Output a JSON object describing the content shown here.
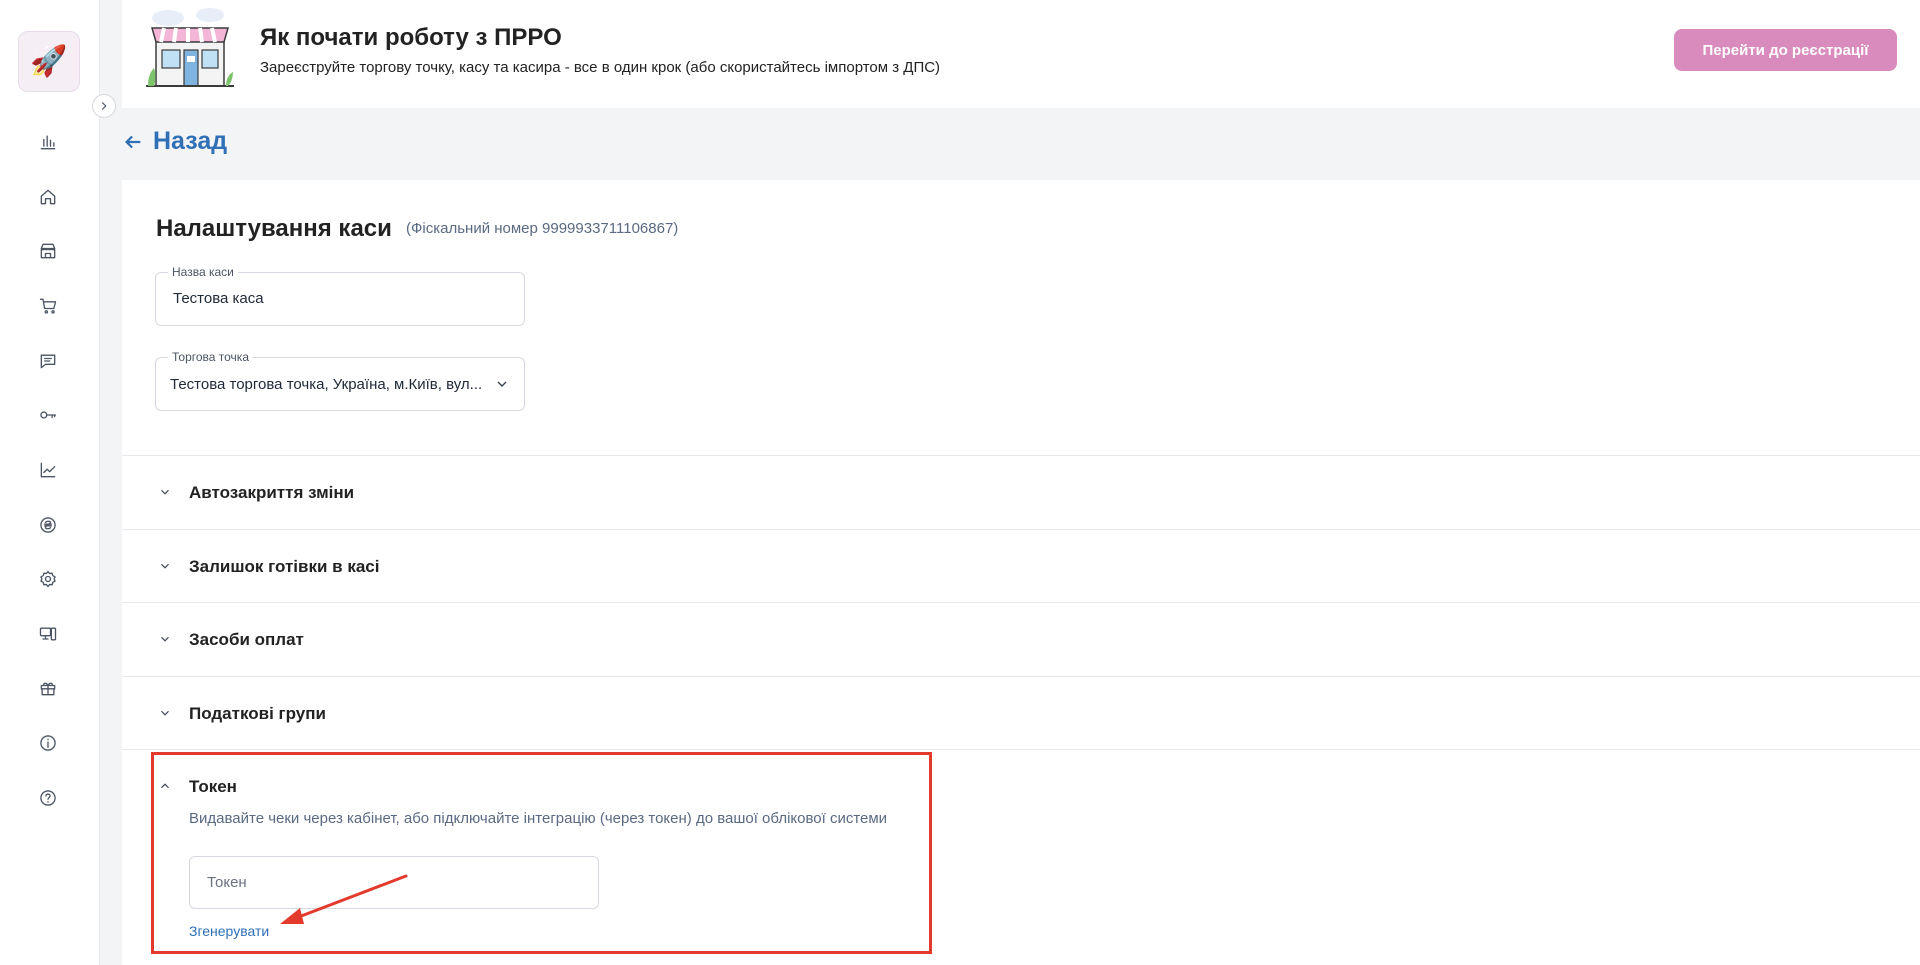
{
  "banner": {
    "title": "Як почати роботу з ПРРО",
    "subtitle": "Зареєструйте торгову точку, касу та касира - все в один крок (або скористайтесь імпортом з ДПС)",
    "register_button": "Перейти до реєстрації",
    "accent_color": "#d98bbd"
  },
  "sidebar": {
    "logo_icon": "rocket-icon",
    "icons": [
      "bar-chart-icon",
      "home-icon",
      "store-icon",
      "cart-icon",
      "message-icon",
      "key-icon",
      "trend-chart-icon",
      "hryvnia-coin-icon",
      "settings-gear-icon",
      "devices-icon",
      "gift-icon",
      "info-icon",
      "help-icon"
    ]
  },
  "back": {
    "label": "Назад"
  },
  "page": {
    "title": "Налаштування каси",
    "fiscal_number": "(Фіскальний номер 9999933711106867)",
    "cash_name_label": "Назва каси",
    "cash_name_value": "Тестова каса",
    "outlet_label": "Торгова точка",
    "outlet_value": "Тестова торгова точка, Україна, м.Київ, вул..."
  },
  "sections": [
    {
      "label": "Автозакриття зміни"
    },
    {
      "label": "Залишок готівки в касі"
    },
    {
      "label": "Засоби оплат"
    },
    {
      "label": "Податкові групи"
    }
  ],
  "token": {
    "label": "Токен",
    "description": "Видавайте чеки через кабінет, або підключайте інтеграцію (через токен) до вашої облікової системи",
    "input_placeholder": "Токен",
    "generate_link": "Згенерувати"
  },
  "colors": {
    "link": "#2f6fb5",
    "highlight": "#e23b2e"
  }
}
